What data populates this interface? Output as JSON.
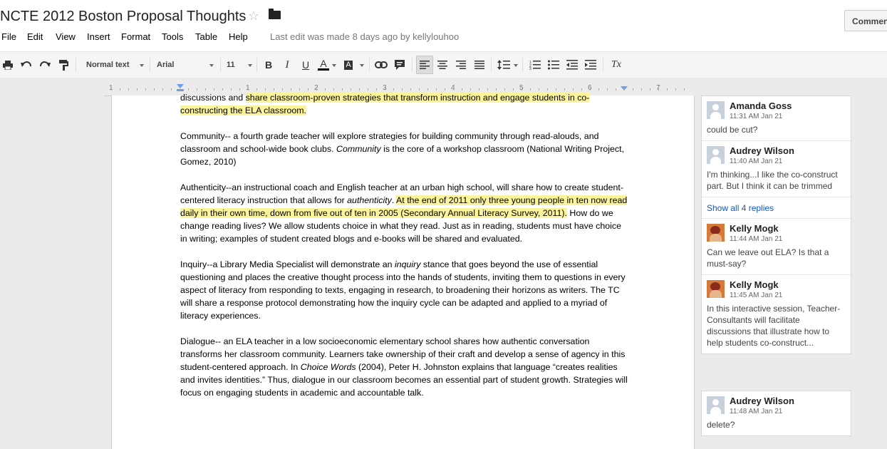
{
  "doc": {
    "title": "NCTE 2012 Boston Proposal Thoughts",
    "last_edit": "Last edit was made 8 days ago by kellylouhoo",
    "comments_button": "Comments"
  },
  "menu": [
    "File",
    "Edit",
    "View",
    "Insert",
    "Format",
    "Tools",
    "Table",
    "Help"
  ],
  "toolbar": {
    "style": "Normal text",
    "font": "Arial",
    "size": "11",
    "bold": "B",
    "italic": "I",
    "underline": "U",
    "text_color": "A",
    "highlight": "A",
    "clear_format": "Tx"
  },
  "ruler": [
    "1",
    "1",
    "2",
    "3",
    "4",
    "5",
    "6",
    "7"
  ],
  "body": {
    "p1a": "discussions and ",
    "p1b": "share classroom-proven strategies that transform instruction and engage students in co-constructing the ELA classroom.",
    "p2a": "Community-- a fourth grade teacher will explore strategies for building community through read-alouds, and classroom and school-wide book clubs. ",
    "p2b": "Community",
    "p2c": " is the core of a workshop classroom (National Writing Project, Gomez, 2010)",
    "p3a": "Authenticity--an instructional coach and English teacher at an urban high school, will share how to create student-centered literacy instruction that allows for ",
    "p3b": "authenticity",
    "p3c": ". ",
    "p3d": "At the end of 2011 only three young people in ten now read daily in their own time, down from five out of ten in 2005 (Secondary Annual Literacy Survey, 2011).",
    "p3e": " How do we change reading lives? We allow students choice in what they read. Just as in reading, students must have choice in writing; examples of student created blogs and e-books will be shared and evaluated.",
    "p4a": "Inquiry--a Library Media Specialist will demonstrate an ",
    "p4b": "inquiry",
    "p4c": " stance that goes beyond the use of essential questioning and places the creative thought process into the hands of students, inviting them to questions in every aspect of literacy from responding to texts, engaging in research, to broadening their horizons as writers.  The TC will share a response protocol demonstrating how the inquiry cycle can be adapted and applied to a myriad of literacy experiences.",
    "p5a": "Dialogue-- an ELA teacher in a low socioeconomic elementary school shares how authentic conversation transforms her classroom community. Learners take ownership of their craft and develop a sense of agency in this student-centered approach. In ",
    "p5b": "Choice Words",
    "p5c": " (2004), Peter H. Johnston explains that language “creates realities and invites identities.” Thus, dialogue in our classroom becomes an essential part of student growth. Strategies will focus on engaging students in academic and accountable talk."
  },
  "comments": {
    "thread1": [
      {
        "name": "Amanda Goss",
        "time": "11:31 AM Jan 21",
        "text": "could be cut?"
      },
      {
        "name": "Audrey Wilson",
        "time": "11:40 AM Jan 21",
        "text": "I'm thinking...I like the co-construct part. But I think it can be trimmed"
      },
      {
        "show_all": "Show all 4 replies"
      },
      {
        "name": "Kelly Mogk",
        "time": "11:44 AM Jan 21",
        "text": "Can we leave out ELA? Is that a must-say?"
      },
      {
        "name": "Kelly Mogk",
        "time": "11:45 AM Jan 21",
        "text": "In this interactive session, Teacher-Consultants will facilitate discussions that illustrate how to help students co-construct..."
      }
    ],
    "thread2": [
      {
        "name": "Audrey Wilson",
        "time": "11:48 AM Jan 21",
        "text": "delete?"
      }
    ]
  },
  "colors": {
    "highlight": "#fcf49a",
    "link": "#1155cc",
    "toolbar_bg": "#f5f5f5",
    "workspace_bg": "#ebebeb"
  }
}
